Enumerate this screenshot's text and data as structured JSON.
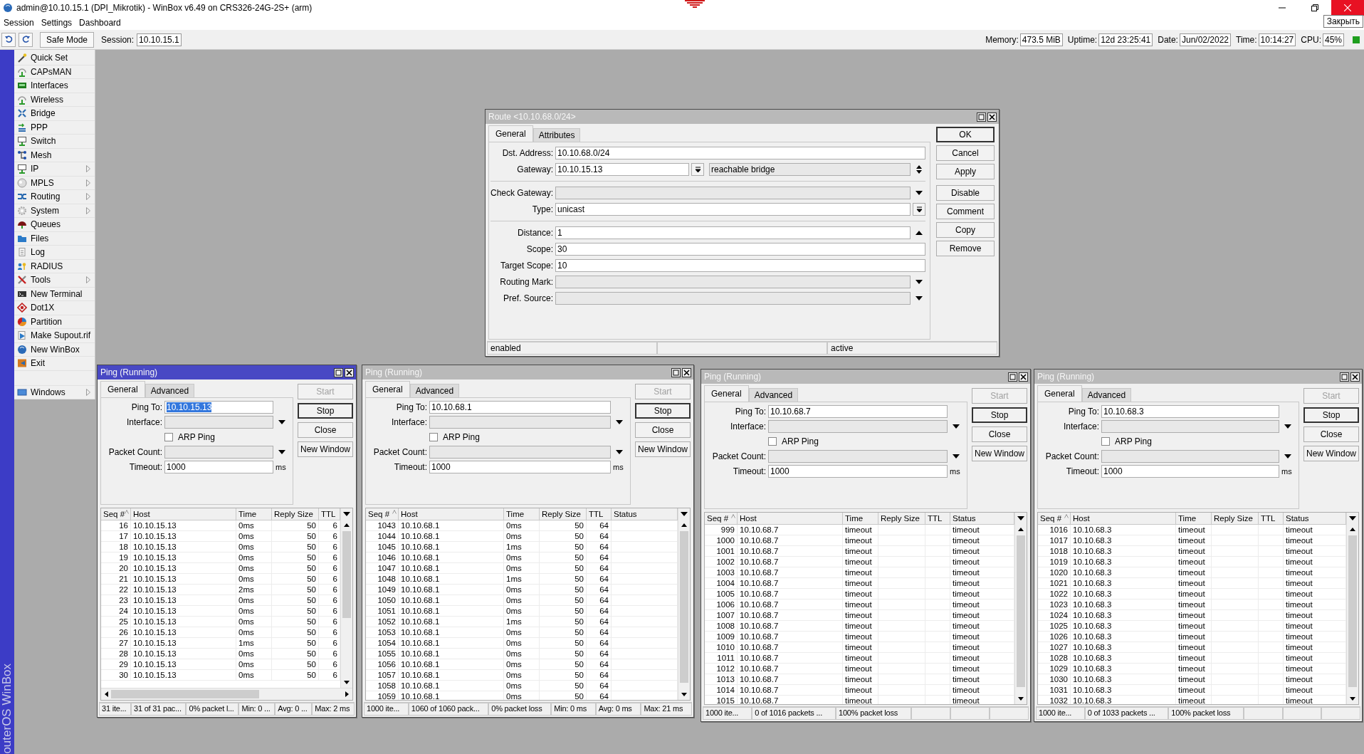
{
  "window": {
    "title": "admin@10.10.15.1 (DPI_Mikrotik) - WinBox v6.49 on CRS326-24G-2S+ (arm)",
    "close_tooltip": "Закрыть"
  },
  "menu": [
    "Session",
    "Settings",
    "Dashboard"
  ],
  "toolbar": {
    "safe_mode": "Safe Mode",
    "session_label": "Session:",
    "session": "10.10.15.1",
    "status": [
      {
        "label": "Memory:",
        "value": "473.5 MiB"
      },
      {
        "label": "Uptime:",
        "value": "12d 23:25:41"
      },
      {
        "label": "Date:",
        "value": "Jun/02/2022"
      },
      {
        "label": "Time:",
        "value": "10:14:27"
      },
      {
        "label": "CPU:",
        "value": "45%"
      }
    ]
  },
  "side_brand": "outerOS WinBox",
  "sidebar": {
    "items": [
      {
        "label": "Quick Set",
        "submenu": false
      },
      {
        "label": "CAPsMAN",
        "submenu": false
      },
      {
        "label": "Interfaces",
        "submenu": false
      },
      {
        "label": "Wireless",
        "submenu": false
      },
      {
        "label": "Bridge",
        "submenu": false
      },
      {
        "label": "PPP",
        "submenu": false
      },
      {
        "label": "Switch",
        "submenu": false
      },
      {
        "label": "Mesh",
        "submenu": false
      },
      {
        "label": "IP",
        "submenu": true
      },
      {
        "label": "MPLS",
        "submenu": true
      },
      {
        "label": "Routing",
        "submenu": true
      },
      {
        "label": "System",
        "submenu": true
      },
      {
        "label": "Queues",
        "submenu": false
      },
      {
        "label": "Files",
        "submenu": false
      },
      {
        "label": "Log",
        "submenu": false
      },
      {
        "label": "RADIUS",
        "submenu": false
      },
      {
        "label": "Tools",
        "submenu": true
      },
      {
        "label": "New Terminal",
        "submenu": false
      },
      {
        "label": "Dot1X",
        "submenu": false
      },
      {
        "label": "Partition",
        "submenu": false
      },
      {
        "label": "Make Supout.rif",
        "submenu": false
      },
      {
        "label": "New WinBox",
        "submenu": false
      },
      {
        "label": "Exit",
        "submenu": false
      }
    ],
    "bottom_items": [
      {
        "label": "Windows",
        "submenu": true
      }
    ]
  },
  "route": {
    "title": "Route <10.10.68.0/24>",
    "active": false,
    "tabs": [
      {
        "label": "General",
        "selected": true
      },
      {
        "label": "Attributes",
        "selected": false
      }
    ],
    "fields": [
      {
        "kind": "text",
        "label": "Dst. Address:",
        "value": "10.10.68.0/24"
      },
      {
        "kind": "gateway",
        "label": "Gateway:",
        "value": "10.10.15.13",
        "state": "reachable bridge"
      },
      {
        "kind": "separator"
      },
      {
        "kind": "combo",
        "label": "Check Gateway:"
      },
      {
        "kind": "select",
        "label": "Type:",
        "value": "unicast"
      },
      {
        "kind": "separator"
      },
      {
        "kind": "spin",
        "label": "Distance:",
        "value": "1"
      },
      {
        "kind": "text",
        "label": "Scope:",
        "value": "30"
      },
      {
        "kind": "text",
        "label": "Target Scope:",
        "value": "10"
      },
      {
        "kind": "combo",
        "label": "Routing Mark:"
      },
      {
        "kind": "combo",
        "label": "Pref. Source:"
      }
    ],
    "button_groups": [
      [
        {
          "label": "OK",
          "default": true
        },
        {
          "label": "Cancel",
          "default": false
        },
        {
          "label": "Apply",
          "default": false
        }
      ],
      [
        {
          "label": "Disable",
          "default": false
        },
        {
          "label": "Comment",
          "default": false
        },
        {
          "label": "Copy",
          "default": false
        },
        {
          "label": "Remove",
          "default": false
        }
      ]
    ],
    "status_bar": {
      "left": "enabled",
      "right": "active"
    }
  },
  "pings": [
    {
      "title": "Ping (Running)",
      "active": true,
      "tabs": [
        {
          "label": "General",
          "selected": true
        },
        {
          "label": "Advanced",
          "selected": false
        }
      ],
      "form": [
        {
          "kind": "text",
          "label": "Ping To:",
          "value": "10.10.15.13",
          "highlighted": true
        },
        {
          "kind": "combo",
          "label": "Interface:"
        },
        {
          "kind": "checkbox",
          "label": "ARP Ping",
          "checked": false
        },
        {
          "kind": "combo",
          "label": "Packet Count:"
        },
        {
          "kind": "text",
          "label": "Timeout:",
          "value": "1000",
          "unit": "ms",
          "highlighted": false
        }
      ],
      "buttons": [
        {
          "label": "Start",
          "disabled": true,
          "default": false
        },
        {
          "label": "Stop",
          "disabled": false,
          "default": true
        },
        {
          "label": "Close",
          "disabled": false,
          "default": false
        },
        {
          "label": "New Window",
          "disabled": false,
          "default": false
        }
      ],
      "columns": [
        {
          "label": "Seq #",
          "sorted": true
        },
        {
          "label": "Host",
          "sorted": false
        },
        {
          "label": "Time",
          "sorted": false
        },
        {
          "label": "Reply Size",
          "sorted": false
        },
        {
          "label": "TTL",
          "sorted": false
        }
      ],
      "rows": [
        {
          "seq": "16",
          "host": "10.10.15.13",
          "time": "0ms",
          "reply_size": "50",
          "ttl": "6"
        },
        {
          "seq": "17",
          "host": "10.10.15.13",
          "time": "0ms",
          "reply_size": "50",
          "ttl": "6"
        },
        {
          "seq": "18",
          "host": "10.10.15.13",
          "time": "0ms",
          "reply_size": "50",
          "ttl": "6"
        },
        {
          "seq": "19",
          "host": "10.10.15.13",
          "time": "0ms",
          "reply_size": "50",
          "ttl": "6"
        },
        {
          "seq": "20",
          "host": "10.10.15.13",
          "time": "0ms",
          "reply_size": "50",
          "ttl": "6"
        },
        {
          "seq": "21",
          "host": "10.10.15.13",
          "time": "0ms",
          "reply_size": "50",
          "ttl": "6"
        },
        {
          "seq": "22",
          "host": "10.10.15.13",
          "time": "2ms",
          "reply_size": "50",
          "ttl": "6"
        },
        {
          "seq": "23",
          "host": "10.10.15.13",
          "time": "0ms",
          "reply_size": "50",
          "ttl": "6"
        },
        {
          "seq": "24",
          "host": "10.10.15.13",
          "time": "0ms",
          "reply_size": "50",
          "ttl": "6"
        },
        {
          "seq": "25",
          "host": "10.10.15.13",
          "time": "0ms",
          "reply_size": "50",
          "ttl": "6"
        },
        {
          "seq": "26",
          "host": "10.10.15.13",
          "time": "0ms",
          "reply_size": "50",
          "ttl": "6"
        },
        {
          "seq": "27",
          "host": "10.10.15.13",
          "time": "1ms",
          "reply_size": "50",
          "ttl": "6"
        },
        {
          "seq": "28",
          "host": "10.10.15.13",
          "time": "0ms",
          "reply_size": "50",
          "ttl": "6"
        },
        {
          "seq": "29",
          "host": "10.10.15.13",
          "time": "0ms",
          "reply_size": "50",
          "ttl": "6"
        },
        {
          "seq": "30",
          "host": "10.10.15.13",
          "time": "0ms",
          "reply_size": "50",
          "ttl": "6"
        }
      ],
      "horizontal_scrollbar": true,
      "status_bar": [
        "31 ite...",
        "31 of 31 pac...",
        "0% packet l...",
        "Min: 0 ...",
        "Avg: 0 ...",
        "Max: 2 ms"
      ]
    },
    {
      "title": "Ping (Running)",
      "active": false,
      "tabs": [
        {
          "label": "General",
          "selected": true
        },
        {
          "label": "Advanced",
          "selected": false
        }
      ],
      "form": [
        {
          "kind": "text",
          "label": "Ping To:",
          "value": "10.10.68.1",
          "highlighted": false
        },
        {
          "kind": "combo",
          "label": "Interface:"
        },
        {
          "kind": "checkbox",
          "label": "ARP Ping",
          "checked": false
        },
        {
          "kind": "combo",
          "label": "Packet Count:"
        },
        {
          "kind": "text",
          "label": "Timeout:",
          "value": "1000",
          "unit": "ms",
          "highlighted": false
        }
      ],
      "buttons": [
        {
          "label": "Start",
          "disabled": true,
          "default": false
        },
        {
          "label": "Stop",
          "disabled": false,
          "default": true
        },
        {
          "label": "Close",
          "disabled": false,
          "default": false
        },
        {
          "label": "New Window",
          "disabled": false,
          "default": false
        }
      ],
      "columns": [
        {
          "label": "Seq #",
          "sorted": true
        },
        {
          "label": "Host",
          "sorted": false
        },
        {
          "label": "Time",
          "sorted": false
        },
        {
          "label": "Reply Size",
          "sorted": false
        },
        {
          "label": "TTL",
          "sorted": false
        },
        {
          "label": "Status",
          "sorted": false
        }
      ],
      "rows": [
        {
          "seq": "1043",
          "host": "10.10.68.1",
          "time": "0ms",
          "reply_size": "50",
          "ttl": "64"
        },
        {
          "seq": "1044",
          "host": "10.10.68.1",
          "time": "0ms",
          "reply_size": "50",
          "ttl": "64"
        },
        {
          "seq": "1045",
          "host": "10.10.68.1",
          "time": "1ms",
          "reply_size": "50",
          "ttl": "64"
        },
        {
          "seq": "1046",
          "host": "10.10.68.1",
          "time": "0ms",
          "reply_size": "50",
          "ttl": "64"
        },
        {
          "seq": "1047",
          "host": "10.10.68.1",
          "time": "0ms",
          "reply_size": "50",
          "ttl": "64"
        },
        {
          "seq": "1048",
          "host": "10.10.68.1",
          "time": "1ms",
          "reply_size": "50",
          "ttl": "64"
        },
        {
          "seq": "1049",
          "host": "10.10.68.1",
          "time": "0ms",
          "reply_size": "50",
          "ttl": "64"
        },
        {
          "seq": "1050",
          "host": "10.10.68.1",
          "time": "0ms",
          "reply_size": "50",
          "ttl": "64"
        },
        {
          "seq": "1051",
          "host": "10.10.68.1",
          "time": "0ms",
          "reply_size": "50",
          "ttl": "64"
        },
        {
          "seq": "1052",
          "host": "10.10.68.1",
          "time": "1ms",
          "reply_size": "50",
          "ttl": "64"
        },
        {
          "seq": "1053",
          "host": "10.10.68.1",
          "time": "0ms",
          "reply_size": "50",
          "ttl": "64"
        },
        {
          "seq": "1054",
          "host": "10.10.68.1",
          "time": "0ms",
          "reply_size": "50",
          "ttl": "64"
        },
        {
          "seq": "1055",
          "host": "10.10.68.1",
          "time": "0ms",
          "reply_size": "50",
          "ttl": "64"
        },
        {
          "seq": "1056",
          "host": "10.10.68.1",
          "time": "0ms",
          "reply_size": "50",
          "ttl": "64"
        },
        {
          "seq": "1057",
          "host": "10.10.68.1",
          "time": "0ms",
          "reply_size": "50",
          "ttl": "64"
        },
        {
          "seq": "1058",
          "host": "10.10.68.1",
          "time": "0ms",
          "reply_size": "50",
          "ttl": "64"
        },
        {
          "seq": "1059",
          "host": "10.10.68.1",
          "time": "0ms",
          "reply_size": "50",
          "ttl": "64"
        }
      ],
      "horizontal_scrollbar": false,
      "status_bar": [
        "1000 ite...",
        "1060 of 1060 pack...",
        "0% packet loss",
        "Min: 0 ms",
        "Avg: 0 ms",
        "Max: 21 ms"
      ]
    },
    {
      "title": "Ping (Running)",
      "active": false,
      "tabs": [
        {
          "label": "General",
          "selected": true
        },
        {
          "label": "Advanced",
          "selected": false
        }
      ],
      "form": [
        {
          "kind": "text",
          "label": "Ping To:",
          "value": "10.10.68.7",
          "highlighted": false
        },
        {
          "kind": "combo",
          "label": "Interface:"
        },
        {
          "kind": "checkbox",
          "label": "ARP Ping",
          "checked": false
        },
        {
          "kind": "combo",
          "label": "Packet Count:"
        },
        {
          "kind": "text",
          "label": "Timeout:",
          "value": "1000",
          "unit": "ms",
          "highlighted": false
        }
      ],
      "buttons": [
        {
          "label": "Start",
          "disabled": true,
          "default": false
        },
        {
          "label": "Stop",
          "disabled": false,
          "default": true
        },
        {
          "label": "Close",
          "disabled": false,
          "default": false
        },
        {
          "label": "New Window",
          "disabled": false,
          "default": false
        }
      ],
      "columns": [
        {
          "label": "Seq #",
          "sorted": true
        },
        {
          "label": "Host",
          "sorted": false
        },
        {
          "label": "Time",
          "sorted": false
        },
        {
          "label": "Reply Size",
          "sorted": false
        },
        {
          "label": "TTL",
          "sorted": false
        },
        {
          "label": "Status",
          "sorted": false
        }
      ],
      "rows": [
        {
          "seq": "999",
          "host": "10.10.68.7",
          "time": "timeout",
          "status": "timeout"
        },
        {
          "seq": "1000",
          "host": "10.10.68.7",
          "time": "timeout",
          "status": "timeout"
        },
        {
          "seq": "1001",
          "host": "10.10.68.7",
          "time": "timeout",
          "status": "timeout"
        },
        {
          "seq": "1002",
          "host": "10.10.68.7",
          "time": "timeout",
          "status": "timeout"
        },
        {
          "seq": "1003",
          "host": "10.10.68.7",
          "time": "timeout",
          "status": "timeout"
        },
        {
          "seq": "1004",
          "host": "10.10.68.7",
          "time": "timeout",
          "status": "timeout"
        },
        {
          "seq": "1005",
          "host": "10.10.68.7",
          "time": "timeout",
          "status": "timeout"
        },
        {
          "seq": "1006",
          "host": "10.10.68.7",
          "time": "timeout",
          "status": "timeout"
        },
        {
          "seq": "1007",
          "host": "10.10.68.7",
          "time": "timeout",
          "status": "timeout"
        },
        {
          "seq": "1008",
          "host": "10.10.68.7",
          "time": "timeout",
          "status": "timeout"
        },
        {
          "seq": "1009",
          "host": "10.10.68.7",
          "time": "timeout",
          "status": "timeout"
        },
        {
          "seq": "1010",
          "host": "10.10.68.7",
          "time": "timeout",
          "status": "timeout"
        },
        {
          "seq": "1011",
          "host": "10.10.68.7",
          "time": "timeout",
          "status": "timeout"
        },
        {
          "seq": "1012",
          "host": "10.10.68.7",
          "time": "timeout",
          "status": "timeout"
        },
        {
          "seq": "1013",
          "host": "10.10.68.7",
          "time": "timeout",
          "status": "timeout"
        },
        {
          "seq": "1014",
          "host": "10.10.68.7",
          "time": "timeout",
          "status": "timeout"
        },
        {
          "seq": "1015",
          "host": "10.10.68.7",
          "time": "timeout",
          "status": "timeout"
        }
      ],
      "horizontal_scrollbar": false,
      "status_bar": [
        "1000 ite...",
        "0 of 1016 packets ...",
        "100% packet loss"
      ]
    },
    {
      "title": "Ping (Running)",
      "active": false,
      "tabs": [
        {
          "label": "General",
          "selected": true
        },
        {
          "label": "Advanced",
          "selected": false
        }
      ],
      "form": [
        {
          "kind": "text",
          "label": "Ping To:",
          "value": "10.10.68.3",
          "highlighted": false
        },
        {
          "kind": "combo",
          "label": "Interface:"
        },
        {
          "kind": "checkbox",
          "label": "ARP Ping",
          "checked": false
        },
        {
          "kind": "combo",
          "label": "Packet Count:"
        },
        {
          "kind": "text",
          "label": "Timeout:",
          "value": "1000",
          "unit": "ms",
          "highlighted": false
        }
      ],
      "buttons": [
        {
          "label": "Start",
          "disabled": true,
          "default": false
        },
        {
          "label": "Stop",
          "disabled": false,
          "default": true
        },
        {
          "label": "Close",
          "disabled": false,
          "default": false
        },
        {
          "label": "New Window",
          "disabled": false,
          "default": false
        }
      ],
      "columns": [
        {
          "label": "Seq #",
          "sorted": true
        },
        {
          "label": "Host",
          "sorted": false
        },
        {
          "label": "Time",
          "sorted": false
        },
        {
          "label": "Reply Size",
          "sorted": false
        },
        {
          "label": "TTL",
          "sorted": false
        },
        {
          "label": "Status",
          "sorted": false
        }
      ],
      "rows": [
        {
          "seq": "1016",
          "host": "10.10.68.3",
          "time": "timeout",
          "status": "timeout"
        },
        {
          "seq": "1017",
          "host": "10.10.68.3",
          "time": "timeout",
          "status": "timeout"
        },
        {
          "seq": "1018",
          "host": "10.10.68.3",
          "time": "timeout",
          "status": "timeout"
        },
        {
          "seq": "1019",
          "host": "10.10.68.3",
          "time": "timeout",
          "status": "timeout"
        },
        {
          "seq": "1020",
          "host": "10.10.68.3",
          "time": "timeout",
          "status": "timeout"
        },
        {
          "seq": "1021",
          "host": "10.10.68.3",
          "time": "timeout",
          "status": "timeout"
        },
        {
          "seq": "1022",
          "host": "10.10.68.3",
          "time": "timeout",
          "status": "timeout"
        },
        {
          "seq": "1023",
          "host": "10.10.68.3",
          "time": "timeout",
          "status": "timeout"
        },
        {
          "seq": "1024",
          "host": "10.10.68.3",
          "time": "timeout",
          "status": "timeout"
        },
        {
          "seq": "1025",
          "host": "10.10.68.3",
          "time": "timeout",
          "status": "timeout"
        },
        {
          "seq": "1026",
          "host": "10.10.68.3",
          "time": "timeout",
          "status": "timeout"
        },
        {
          "seq": "1027",
          "host": "10.10.68.3",
          "time": "timeout",
          "status": "timeout"
        },
        {
          "seq": "1028",
          "host": "10.10.68.3",
          "time": "timeout",
          "status": "timeout"
        },
        {
          "seq": "1029",
          "host": "10.10.68.3",
          "time": "timeout",
          "status": "timeout"
        },
        {
          "seq": "1030",
          "host": "10.10.68.3",
          "time": "timeout",
          "status": "timeout"
        },
        {
          "seq": "1031",
          "host": "10.10.68.3",
          "time": "timeout",
          "status": "timeout"
        },
        {
          "seq": "1032",
          "host": "10.10.68.3",
          "time": "timeout",
          "status": "timeout"
        }
      ],
      "horizontal_scrollbar": false,
      "status_bar": [
        "1000 ite...",
        "0 of 1033 packets ...",
        "100% packet loss"
      ]
    }
  ]
}
